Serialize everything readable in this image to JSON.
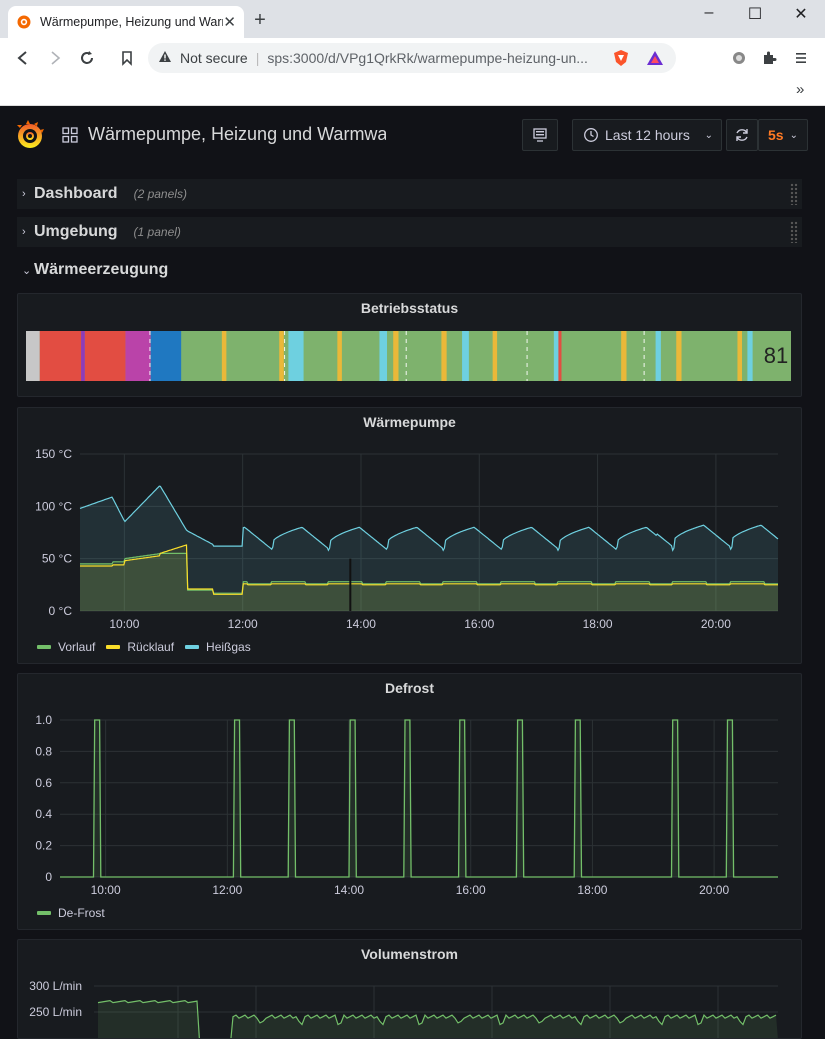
{
  "browser": {
    "tab_title": "Wärmepumpe, Heizung und Warmwasser",
    "not_secure": "Not secure",
    "url": "sps:3000/d/VPg1QrkRk/warmepumpe-heizung-un..."
  },
  "grafana": {
    "dashboard_title": "Wärmepumpe, Heizung und Warmwasser",
    "time_range": "Last 12 hours",
    "refresh": "5s"
  },
  "rows": [
    {
      "title": "Dashboard",
      "count": "(2 panels)",
      "collapsed": true
    },
    {
      "title": "Umgebung",
      "count": "(1 panel)",
      "collapsed": true
    },
    {
      "title": "Wärmeerzeugung",
      "count": "",
      "collapsed": false
    }
  ],
  "panels": {
    "betriebsstatus": {
      "title": "Betriebsstatus",
      "current_value": "81"
    },
    "waermepumpe": {
      "title": "Wärmepumpe",
      "legend": [
        {
          "name": "Vorlauf",
          "color": "#73bf69"
        },
        {
          "name": "Rücklauf",
          "color": "#fade2a"
        },
        {
          "name": "Heißgas",
          "color": "#8ab8ff"
        }
      ]
    },
    "defrost": {
      "title": "Defrost",
      "legend": [
        {
          "name": "De-Frost",
          "color": "#73bf69"
        }
      ]
    },
    "volumenstrom": {
      "title": "Volumenstrom"
    }
  },
  "chart_data": [
    {
      "type": "timeline",
      "title": "Betriebsstatus",
      "segments": [
        {
          "color": "#c7c7c7",
          "start": 0.0,
          "end": 0.018
        },
        {
          "color": "#e24d42",
          "start": 0.018,
          "end": 0.072
        },
        {
          "color": "#8f3bb8",
          "start": 0.072,
          "end": 0.077
        },
        {
          "color": "#e24d42",
          "start": 0.077,
          "end": 0.13
        },
        {
          "color": "#ba43a9",
          "start": 0.13,
          "end": 0.163
        },
        {
          "color": "#1f78c1",
          "start": 0.163,
          "end": 0.203
        },
        {
          "color": "#7eb26d",
          "start": 0.203,
          "end": 0.256
        },
        {
          "color": "#eab839",
          "start": 0.256,
          "end": 0.262
        },
        {
          "color": "#7eb26d",
          "start": 0.262,
          "end": 0.331
        },
        {
          "color": "#eab839",
          "start": 0.331,
          "end": 0.337
        },
        {
          "color": "#6ed0e0",
          "start": 0.343,
          "end": 0.363
        },
        {
          "color": "#7eb26d",
          "start": 0.363,
          "end": 0.407
        },
        {
          "color": "#eab839",
          "start": 0.407,
          "end": 0.413
        },
        {
          "color": "#7eb26d",
          "start": 0.413,
          "end": 0.462
        },
        {
          "color": "#6ed0e0",
          "start": 0.462,
          "end": 0.472
        },
        {
          "color": "#7eb26d",
          "start": 0.472,
          "end": 0.48
        },
        {
          "color": "#eab839",
          "start": 0.48,
          "end": 0.487
        },
        {
          "color": "#7eb26d",
          "start": 0.487,
          "end": 0.543
        },
        {
          "color": "#eab839",
          "start": 0.543,
          "end": 0.55
        },
        {
          "color": "#7eb26d",
          "start": 0.55,
          "end": 0.57
        },
        {
          "color": "#6ed0e0",
          "start": 0.57,
          "end": 0.579
        },
        {
          "color": "#7eb26d",
          "start": 0.579,
          "end": 0.61
        },
        {
          "color": "#eab839",
          "start": 0.61,
          "end": 0.616
        },
        {
          "color": "#7eb26d",
          "start": 0.616,
          "end": 0.69
        },
        {
          "color": "#6ed0e0",
          "start": 0.69,
          "end": 0.696
        },
        {
          "color": "#e24d42",
          "start": 0.696,
          "end": 0.7
        },
        {
          "color": "#7eb26d",
          "start": 0.7,
          "end": 0.778
        },
        {
          "color": "#eab839",
          "start": 0.778,
          "end": 0.785
        },
        {
          "color": "#7eb26d",
          "start": 0.785,
          "end": 0.823
        },
        {
          "color": "#6ed0e0",
          "start": 0.823,
          "end": 0.83
        },
        {
          "color": "#7eb26d",
          "start": 0.83,
          "end": 0.85
        },
        {
          "color": "#eab839",
          "start": 0.85,
          "end": 0.857
        },
        {
          "color": "#7eb26d",
          "start": 0.857,
          "end": 0.93
        },
        {
          "color": "#eab839",
          "start": 0.93,
          "end": 0.936
        },
        {
          "color": "#7eb26d",
          "start": 0.936,
          "end": 0.943
        },
        {
          "color": "#6ed0e0",
          "start": 0.943,
          "end": 0.95
        },
        {
          "color": "#7eb26d",
          "start": 0.95,
          "end": 1.0
        }
      ],
      "value": "81"
    },
    {
      "type": "line",
      "title": "Wärmepumpe",
      "x_ticks": [
        "10:00",
        "12:00",
        "14:00",
        "16:00",
        "18:00",
        "20:00"
      ],
      "y_ticks": [
        "0 °C",
        "50 °C",
        "100 °C",
        "150 °C"
      ],
      "ylim": [
        0,
        150
      ],
      "xlim_hours": [
        9.25,
        21.05
      ],
      "series": [
        {
          "name": "Vorlauf",
          "color": "#73bf69"
        },
        {
          "name": "Rücklauf",
          "color": "#fade2a"
        },
        {
          "name": "Heißgas",
          "color": "#8ab8ff"
        }
      ]
    },
    {
      "type": "line",
      "title": "Defrost",
      "x_ticks": [
        "10:00",
        "12:00",
        "14:00",
        "16:00",
        "18:00",
        "20:00"
      ],
      "y_ticks": [
        "0",
        "0.2",
        "0.4",
        "0.6",
        "0.8",
        "1.0"
      ],
      "ylim": [
        0,
        1
      ],
      "xlim_hours": [
        9.25,
        21.05
      ],
      "series": [
        {
          "name": "De-Frost",
          "color": "#73bf69",
          "pulses_start_hours": [
            9.8,
            12.1,
            13.0,
            14.0,
            14.9,
            15.8,
            16.75,
            17.7,
            19.3,
            20.2
          ],
          "pulse_width_hours": 0.1
        }
      ]
    },
    {
      "type": "line",
      "title": "Volumenstrom",
      "y_ticks": [
        "250 L/min",
        "300 L/min"
      ],
      "ylim": [
        200,
        300
      ]
    }
  ]
}
